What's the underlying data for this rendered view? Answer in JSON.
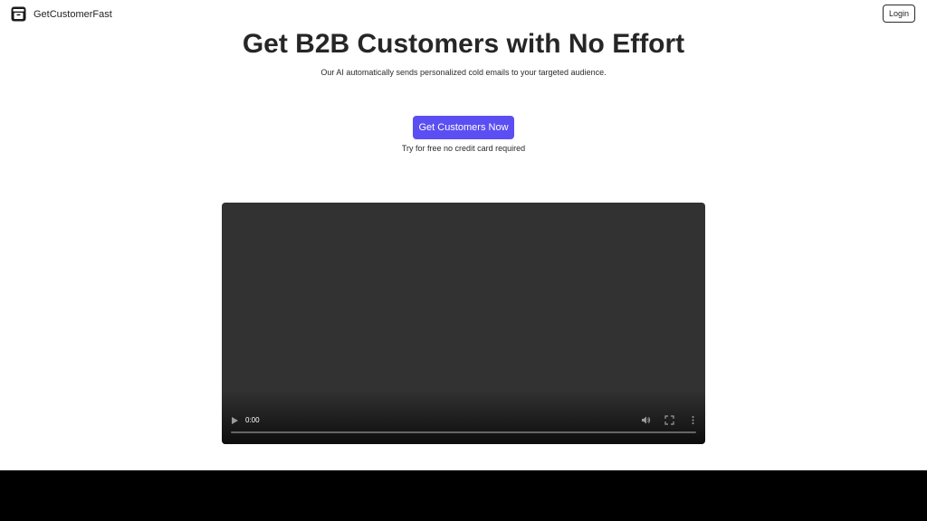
{
  "header": {
    "brand_name": "GetCustomerFast",
    "login_label": "Login"
  },
  "hero": {
    "title": "Get B2B Customers with No Effort",
    "subtitle": "Our AI automatically sends personalized cold emails to your targeted audience.",
    "cta_label": "Get Customers Now",
    "cta_note": "Try for free no credit card required"
  },
  "video": {
    "current_time": "0:00",
    "progress": 0,
    "icons": {
      "play": "play-icon",
      "volume": "volume-icon",
      "fullscreen": "fullscreen-icon",
      "more": "more-options-icon"
    }
  },
  "colors": {
    "cta_background": "#5b4ef2",
    "video_background": "#323232",
    "footer_background": "#000000"
  }
}
